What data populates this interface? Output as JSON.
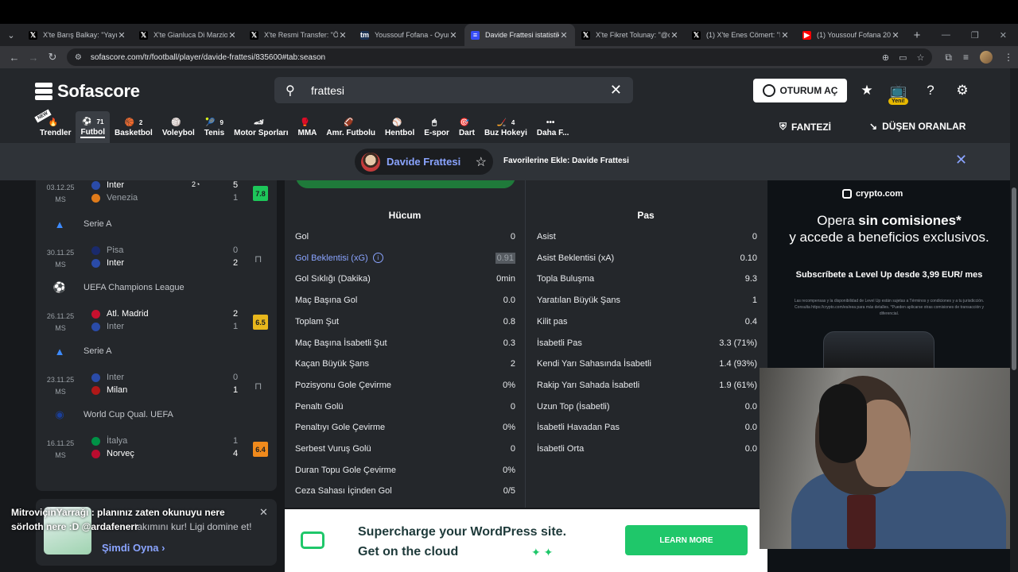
{
  "browser": {
    "tabs": [
      {
        "title": "X'te Barış Balkay: \"Yayınd",
        "favicon": "x-logo-icon"
      },
      {
        "title": "X'te Gianluca Di Marzio: \"",
        "favicon": "x-logo-icon"
      },
      {
        "title": "X'te Resmi Transfer: \"ÖZE",
        "favicon": "x-logo-icon"
      },
      {
        "title": "Youssouf Fofana - Oyuncu",
        "favicon": "transfermarkt-icon"
      },
      {
        "title": "Davide Frattesi istatistikle",
        "favicon": "sofascore-icon",
        "active": true
      },
      {
        "title": "X'te Fikret Tolunay: \"@og",
        "favicon": "x-logo-icon"
      },
      {
        "title": "(1) X'te Enes Cömert: \"Ma",
        "favicon": "x-logo-icon"
      },
      {
        "title": "(1) Youssouf Fofana 2024",
        "favicon": "youtube-icon"
      }
    ],
    "url": "sofascore.com/tr/football/player/davide-frattesi/835600#tab:season"
  },
  "header": {
    "logo_text": "Sofascore",
    "search_value": "frattesi",
    "login_label": "OTURUM AÇ",
    "tv_badge": "Yeni!",
    "fantasy_label": "FANTEZİ",
    "dropping_odds_label": "DÜŞEN ORANLAR",
    "new_flag": "NEW",
    "sports": [
      {
        "label": "Trendler",
        "count": "",
        "icon": "🔥"
      },
      {
        "label": "Futbol",
        "count": "71",
        "icon": "⚽",
        "active": true
      },
      {
        "label": "Basketbol",
        "count": "2",
        "icon": "🏀"
      },
      {
        "label": "Voleybol",
        "count": "",
        "icon": "🏐"
      },
      {
        "label": "Tenis",
        "count": "9",
        "icon": "🎾"
      },
      {
        "label": "Motor Sporları",
        "count": "",
        "icon": "🏎"
      },
      {
        "label": "MMA",
        "count": "",
        "icon": "🥊"
      },
      {
        "label": "Amr. Futbolu",
        "count": "",
        "icon": "🏈"
      },
      {
        "label": "Hentbol",
        "count": "",
        "icon": "⚾"
      },
      {
        "label": "E-spor",
        "count": "",
        "icon": "🖱"
      },
      {
        "label": "Dart",
        "count": "",
        "icon": "🎯"
      },
      {
        "label": "Buz Hokeyi",
        "count": "4",
        "icon": "🏒"
      },
      {
        "label": "Daha F...",
        "count": "",
        "icon": "•••"
      }
    ]
  },
  "player_bar": {
    "name": "Davide Frattesi",
    "favorite_text": "Favorilerine Ekle: Davide Frattesi"
  },
  "matches": [
    {
      "date": "03.12.25",
      "status": "MS",
      "home": "Inter",
      "away": "Venezia",
      "home_score": "5",
      "away_score": "1",
      "rating": "7.8",
      "rating_color": "#1dc75a",
      "minute": "2",
      "winner": "home"
    },
    {
      "league": "Serie A"
    },
    {
      "date": "30.11.25",
      "status": "MS",
      "home": "Pisa",
      "away": "Inter",
      "home_score": "0",
      "away_score": "2",
      "rating": "",
      "winner": "away"
    },
    {
      "league": "UEFA Champions League"
    },
    {
      "date": "26.11.25",
      "status": "MS",
      "home": "Atl. Madrid",
      "away": "Inter",
      "home_score": "2",
      "away_score": "1",
      "rating": "6.5",
      "rating_color": "#e8b71c",
      "winner": "home"
    },
    {
      "league": "Serie A"
    },
    {
      "date": "23.11.25",
      "status": "MS",
      "home": "Inter",
      "away": "Milan",
      "home_score": "0",
      "away_score": "1",
      "rating": "",
      "winner": "away"
    },
    {
      "league": "World Cup Qual. UEFA"
    },
    {
      "date": "16.11.25",
      "status": "MS",
      "home": "İtalya",
      "away": "Norveç",
      "home_score": "1",
      "away_score": "4",
      "rating": "6.4",
      "rating_color": "#f08a1c",
      "winner": "away"
    }
  ],
  "stats": {
    "attack_title": "Hücum",
    "passing_title": "Pas",
    "attack": [
      {
        "label": "Gol",
        "value": "0"
      },
      {
        "label": "Gol Beklentisi (xG)",
        "value": "0.91",
        "link": true
      },
      {
        "label": "Gol Sıklığı (Dakika)",
        "value": "0min"
      },
      {
        "label": "Maç Başına Gol",
        "value": "0.0"
      },
      {
        "label": "Toplam Şut",
        "value": "0.8"
      },
      {
        "label": "Maç Başına İsabetli Şut",
        "value": "0.3"
      },
      {
        "label": "Kaçan Büyük Şans",
        "value": "2"
      },
      {
        "label": "Pozisyonu Gole Çevirme",
        "value": "0%"
      },
      {
        "label": "Penaltı Golü",
        "value": "0"
      },
      {
        "label": "Penaltıyı Gole Çevirme",
        "value": "0%"
      },
      {
        "label": "Serbest Vuruş Golü",
        "value": "0"
      },
      {
        "label": "Duran Topu Gole Çevirme",
        "value": "0%"
      },
      {
        "label": "Ceza Sahası İçinden Gol",
        "value": "0/5"
      }
    ],
    "passing": [
      {
        "label": "Asist",
        "value": "0"
      },
      {
        "label": "Asist Beklentisi (xA)",
        "value": "0.10"
      },
      {
        "label": "Topla Buluşma",
        "value": "9.3"
      },
      {
        "label": "Yaratılan Büyük Şans",
        "value": "1"
      },
      {
        "label": "Kilit pas",
        "value": "0.4"
      },
      {
        "label": "İsabetli Pas",
        "value": "3.3 (71%)"
      },
      {
        "label": "Kendi Yarı Sahasında İsabetli",
        "value": "1.4 (93%)"
      },
      {
        "label": "Rakip Yarı Sahada İsabetli",
        "value": "1.9 (61%)"
      },
      {
        "label": "Uzun Top (İsabetli)",
        "value": "0.0"
      },
      {
        "label": "İsabetli Havadan Pas",
        "value": "0.0"
      },
      {
        "label": "İsabetli Orta",
        "value": "0.0"
      }
    ]
  },
  "ads": {
    "bottom_text": "Supercharge your WordPress site. Get on the cloud",
    "bottom_button": "LEARN MORE",
    "crypto_brand": "crypto.com",
    "crypto_headline_1": "Opera ",
    "crypto_headline_bold": "sin comisiones*",
    "crypto_headline_2": "y accede a beneficios exclusivos.",
    "crypto_sub": "Subscríbete a Level Up desde 3,99 EUR/ mes",
    "crypto_small": "Las recompensas y la disponibilidad de Level Up están sujetas a Términos y condiciones y a tu jurisdicción. Consulta https://crypto.com/es/eea para más detalles. *Pueden aplicarse otras comisiones de transacción y diferencial."
  },
  "toast": {
    "message": "takımını kur! Ligi domine et!",
    "link": "Şimdi Oyna"
  },
  "chat": {
    "line1": "MitroviçinYarrağı : planınız zaten okunuyu nere",
    "line2": "sörloth nere :D @ardafenerr"
  }
}
